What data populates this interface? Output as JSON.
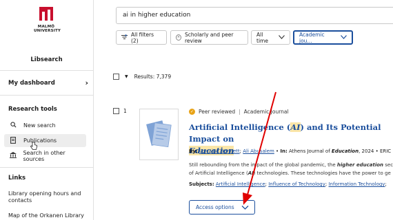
{
  "sidebar": {
    "logo": {
      "line1": "MALMÖ",
      "line2": "UNIVERSITY",
      "color": "#c8102e"
    },
    "app_name": "Libsearch",
    "dashboard_label": "My dashboard",
    "research_tools_title": "Research tools",
    "tools": [
      {
        "label": "New search",
        "icon": "search-icon"
      },
      {
        "label": "Publications",
        "icon": "document-icon"
      },
      {
        "label": "Search in other sources",
        "icon": "library-building-icon"
      }
    ],
    "links_title": "Links",
    "links": [
      {
        "label": "Library opening hours and contacts"
      },
      {
        "label": "Map of the Orkanen Library"
      }
    ]
  },
  "search": {
    "value": "ai in higher education"
  },
  "filters": {
    "all_filters": "All filters (2)",
    "scholarly": "Scholarly and peer review",
    "time": "All time",
    "type": "Academic jou..."
  },
  "results": {
    "count_text": "Results: 7,379"
  },
  "result": {
    "number": "1",
    "peer_reviewed": "Peer reviewed",
    "type": "Academic Journal",
    "title_parts": [
      "Artificial Intelligence (",
      "AI",
      ") and Its Potential Impact on",
      "Education"
    ],
    "by_label": "By:",
    "authors": [
      "Lorraine Bennett",
      "Ali Abusalem"
    ],
    "in_label": "In:",
    "journal_prefix": "Athens Journal of ",
    "journal_em": "Education",
    "year_suffix": ", 2024 • ERIC",
    "abstract_line1_a": "Still rebounding from the impact of the global pandemic, the ",
    "abstract_line1_b": "higher education",
    "abstract_line1_c": " sect",
    "abstract_line2_a": "of Artificial Intelligence (",
    "abstract_line2_b": "AI",
    "abstract_line2_c": ") technologies. These technologies have the power to ge",
    "subjects_label": "Subjects:",
    "subjects": [
      "Artificial Intelligence",
      "Influence of Technology",
      "Information Technology"
    ],
    "access_options": "Access options"
  },
  "colors": {
    "accent": "#1a4e9c",
    "highlight": "#fbe6a8",
    "annotation_arrow": "#e00000",
    "peer_badge": "#e8a317"
  }
}
